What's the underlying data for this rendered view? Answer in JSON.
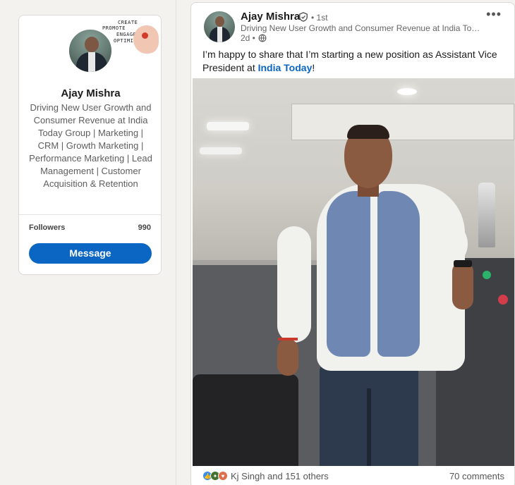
{
  "profile": {
    "name": "Ajay Mishra",
    "headline": "Driving New User Growth and Consumer Revenue at India Today Group | Marketing | CRM | Growth Marketing | Performance Marketing | Lead Management | Customer Acquisition & Retention",
    "cover_words": [
      "CREATE",
      "PROMOTE",
      "ENGAGE",
      "OPTIMIZE"
    ],
    "followers_label": "Followers",
    "followers_count": "990",
    "message_label": "Message"
  },
  "post": {
    "author_name": "Ajay Mishra",
    "verified_icon": "verified-shield-icon",
    "degree": "• 1st",
    "author_headline": "Driving New User Growth and Consumer Revenue at India Today…",
    "time": "2d •",
    "visibility_icon": "globe-icon",
    "more_label": "•••",
    "text_before": "I’m happy to share that I’m starting a new position as Assistant Vice President at ",
    "mention": "India Today",
    "text_after": "!",
    "reactions_text": "Kj Singh and 151 others",
    "comments_text": "70 comments"
  },
  "colors": {
    "accent": "#0a66c2",
    "background": "#f4f2ee",
    "like": "#378fe9",
    "celebrate": "#44712e",
    "love": "#df704d"
  }
}
